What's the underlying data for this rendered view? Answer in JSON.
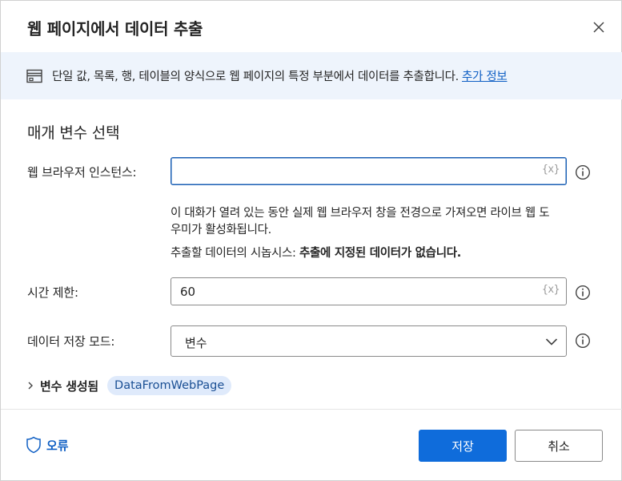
{
  "dialog": {
    "title": "웹 페이지에서 데이터 추출"
  },
  "banner": {
    "text": "단일 값, 목록, 행, 테이블의 양식으로 웹 페이지의 특정 부분에서 데이터를 추출합니다.",
    "link": "추가 정보"
  },
  "section": {
    "title": "매개 변수 선택"
  },
  "fields": {
    "browser_instance": {
      "label": "웹 브라우저 인스턴스:",
      "value": "",
      "var_token": "{x}"
    },
    "help_line": "이 대화가 열려 있는 동안 실제 웹 브라우저 창을 전경으로 가져오면 라이브 웹 도",
    "help_line2": "우미가 활성화됩니다.",
    "preview_prefix": "추출할 데이터의 시놉시스:",
    "preview_value": "추출에 지정된 데이터가 없습니다.",
    "timeout": {
      "label": "시간 제한:",
      "value": "60",
      "var_token": "{x}"
    },
    "storage_mode": {
      "label": "데이터 저장 모드:",
      "value": "변수"
    }
  },
  "variables": {
    "label": "변수 생성됨",
    "chip": "DataFromWebPage"
  },
  "footer": {
    "error_label": "오류",
    "save_label": "저장",
    "cancel_label": "취소"
  },
  "colors": {
    "primary": "#0f6cdb",
    "banner_bg": "#eef4fc",
    "link": "#0f5fc4",
    "chip_bg": "#dfeafb"
  }
}
